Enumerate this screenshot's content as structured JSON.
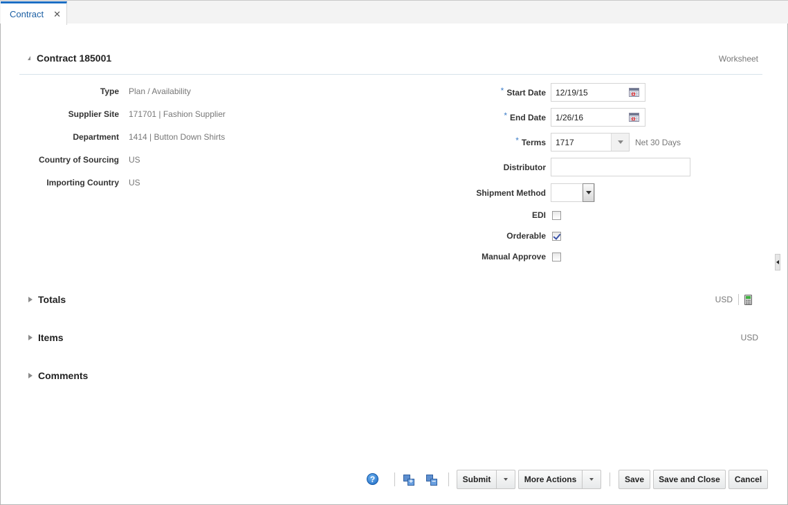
{
  "tabs": [
    {
      "label": "Contract",
      "active": true,
      "closable": true,
      "close_glyph": "✕"
    }
  ],
  "header": {
    "title": "Contract 185001",
    "status": "Worksheet"
  },
  "readonly_fields": [
    {
      "label": "Type",
      "value": "Plan / Availability"
    },
    {
      "label": "Supplier Site",
      "value": "171701 | Fashion Supplier"
    },
    {
      "label": "Department",
      "value": "1414 | Button Down Shirts"
    },
    {
      "label": "Country of Sourcing",
      "value": "US"
    },
    {
      "label": "Importing Country",
      "value": "US"
    }
  ],
  "form": {
    "required_marker": "*",
    "start_date": {
      "label": "Start Date",
      "value": "12/19/15",
      "required": true,
      "icon": "calendar-icon"
    },
    "end_date": {
      "label": "End Date",
      "value": "1/26/16",
      "required": true,
      "icon": "calendar-icon"
    },
    "terms": {
      "label": "Terms",
      "value": "1717",
      "required": true,
      "description": "Net 30 Days"
    },
    "distributor": {
      "label": "Distributor",
      "value": ""
    },
    "shipment_method": {
      "label": "Shipment Method",
      "value": ""
    },
    "edi": {
      "label": "EDI",
      "checked": false
    },
    "orderable": {
      "label": "Orderable",
      "checked": true
    },
    "manual_approve": {
      "label": "Manual Approve",
      "checked": false
    }
  },
  "sections": {
    "totals": {
      "title": "Totals",
      "currency": "USD",
      "icon": "calculator-icon"
    },
    "items": {
      "title": "Items",
      "currency": "USD"
    },
    "comments": {
      "title": "Comments"
    }
  },
  "footer": {
    "help_glyph": "?",
    "expand_glyph": "+",
    "collapse_glyph": "−",
    "buttons": {
      "submit": "Submit",
      "more_actions": "More Actions",
      "save": "Save",
      "save_and_close": "Save and Close",
      "cancel": "Cancel"
    }
  },
  "colors": {
    "accent": "#1c6ec4",
    "required": "#3b7cc8",
    "muted_text": "#777777"
  }
}
